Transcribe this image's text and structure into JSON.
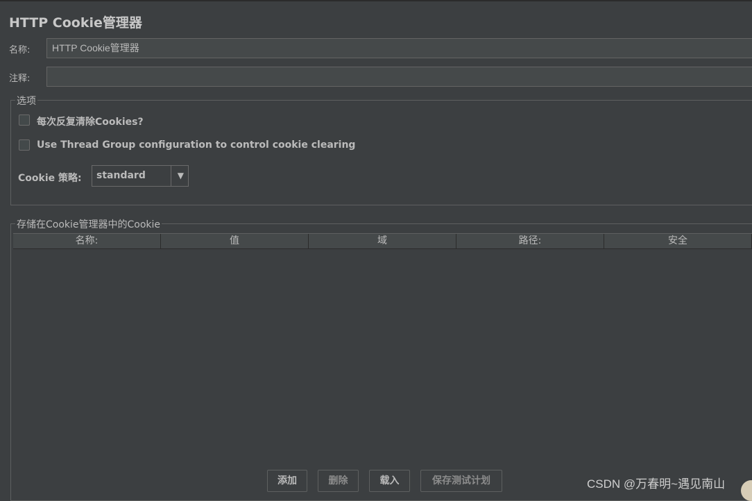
{
  "panel": {
    "title": "HTTP Cookie管理器"
  },
  "fields": {
    "name_label": "名称:",
    "name_value": "HTTP Cookie管理器",
    "comment_label": "注释:",
    "comment_value": ""
  },
  "options": {
    "legend": "选项",
    "clear_each_iteration_label": "每次反复清除Cookies?",
    "clear_each_iteration_checked": false,
    "thread_group_config_label": "Use Thread Group configuration to control cookie clearing",
    "thread_group_config_checked": false,
    "policy_label": "Cookie 策略:",
    "policy_value": "standard",
    "policy_arrow": "▼"
  },
  "cookies": {
    "legend": "存储在Cookie管理器中的Cookie",
    "columns": [
      "名称:",
      "值",
      "域",
      "路径:",
      "安全"
    ],
    "rows": []
  },
  "buttons": {
    "add": "添加",
    "delete": "删除",
    "load": "载入",
    "save": "保存测试计划"
  },
  "watermark": "CSDN @万春明~遇见南山",
  "colors": {
    "background": "#3c3f41",
    "text": "#bbbbbb",
    "field": "#45494a"
  }
}
